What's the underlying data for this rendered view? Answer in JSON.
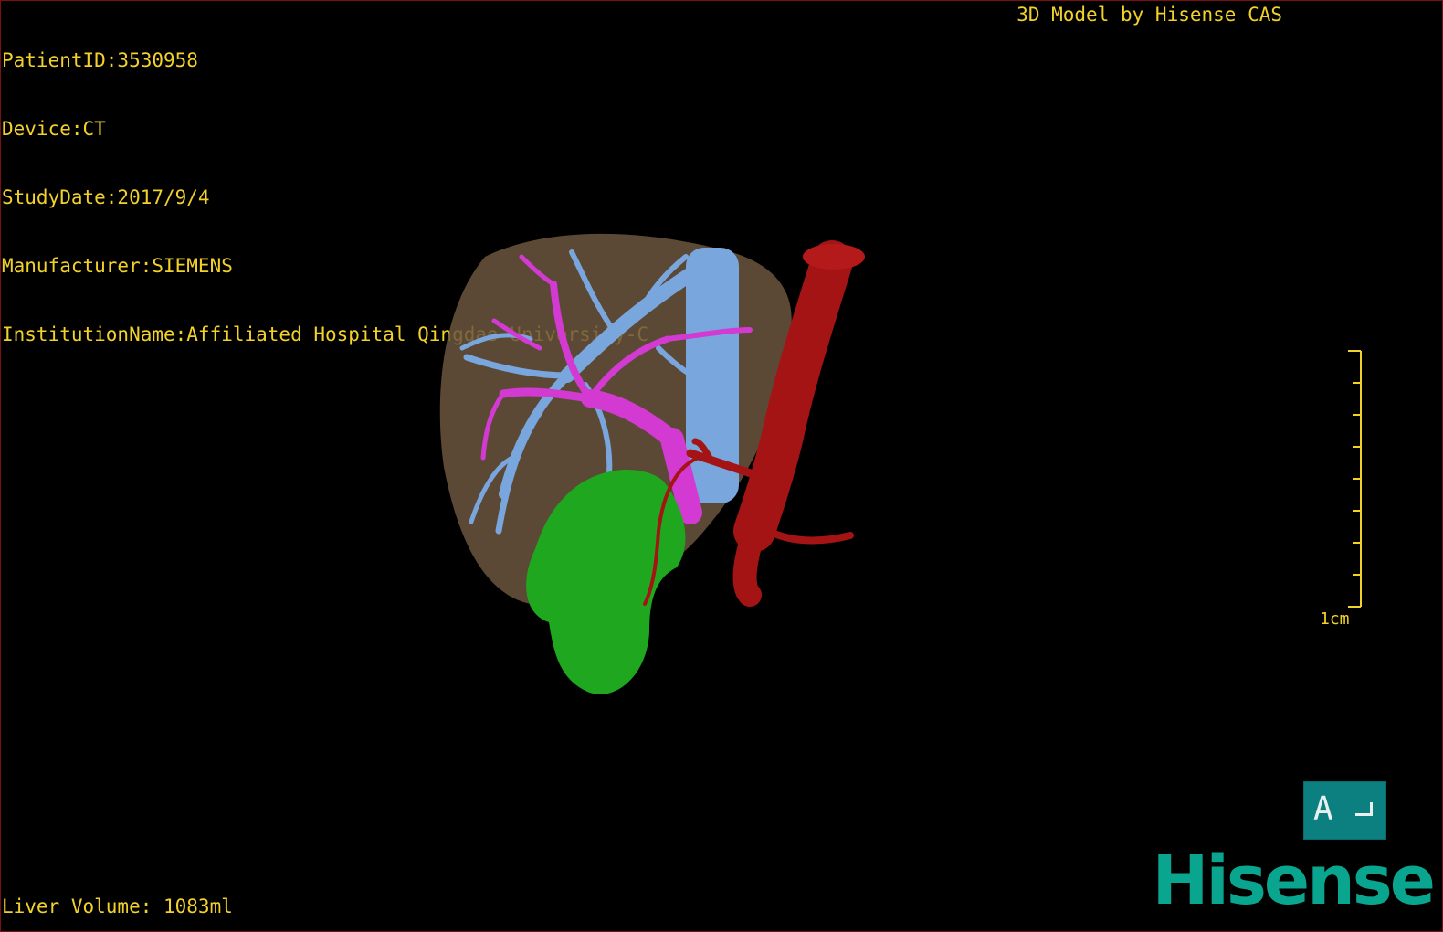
{
  "viewer": {
    "info_lines": [
      "PatientID:3530958",
      "Device:CT",
      "StudyDate:2017/9/4",
      "Manufacturer:SIEMENS",
      "InstitutionName:Affiliated Hospital Qingdao University-C"
    ],
    "credit": "3D Model by Hisense CAS",
    "liver_volume": "Liver Volume: 1083ml",
    "scale_label": "1cm",
    "orientation_letter": "A",
    "brand": "Hisense"
  },
  "model": {
    "structures": [
      {
        "name": "liver",
        "color": "#6b5640"
      },
      {
        "name": "hepatic-veins",
        "color": "#7aa6de"
      },
      {
        "name": "portal-vein",
        "color": "#d23ad2"
      },
      {
        "name": "gallbladder-tumor",
        "color": "#1fa81f"
      },
      {
        "name": "aorta",
        "color": "#a51414"
      }
    ]
  },
  "colors": {
    "overlay_text": "#f2d22a",
    "brand": "#0aa58f",
    "orientation_cube": "#0c7f80",
    "border": "#7a1010"
  }
}
